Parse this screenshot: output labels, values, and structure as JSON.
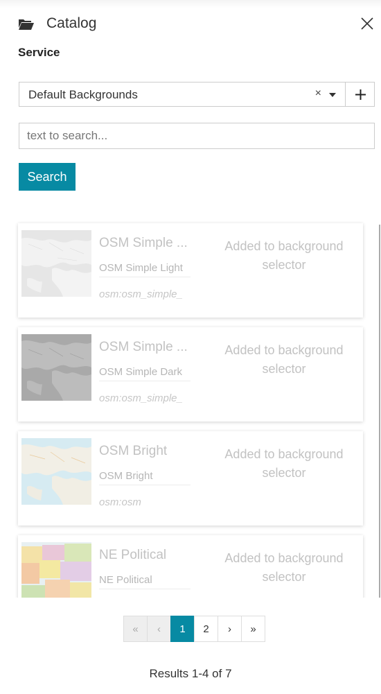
{
  "header": {
    "title": "Catalog"
  },
  "service": {
    "label": "Service",
    "selected": "Default Backgrounds",
    "clear_symbol": "×",
    "add_symbol": "+"
  },
  "search": {
    "placeholder": "text to search...",
    "button_label": "Search"
  },
  "results": [
    {
      "title": "OSM Simple ...",
      "description": "OSM Simple Light",
      "id": "osm:osm_simple_",
      "status": "Added to background selector",
      "thumbnail": "light-map"
    },
    {
      "title": "OSM Simple ...",
      "description": "OSM Simple Dark",
      "id": "osm:osm_simple_",
      "status": "Added to background selector",
      "thumbnail": "dark-map"
    },
    {
      "title": "OSM Bright",
      "description": "OSM Bright",
      "id": "osm:osm",
      "status": "Added to background selector",
      "thumbnail": "bright-map"
    },
    {
      "title": "NE Political",
      "description": "NE Political",
      "id": "",
      "status": "Added to background selector",
      "thumbnail": "political-map"
    }
  ],
  "pagination": {
    "first": "«",
    "prev": "‹",
    "pages": [
      "1",
      "2"
    ],
    "current_page": "1",
    "next": "›",
    "last": "»",
    "summary": "Results 1-4 of 7"
  },
  "colors": {
    "accent": "#078aa3",
    "muted_text": "#c2c2c2"
  },
  "icons": {
    "header": "folder-open-icon",
    "close": "close-icon",
    "dropdown": "caret-down-icon",
    "add": "plus-icon"
  }
}
